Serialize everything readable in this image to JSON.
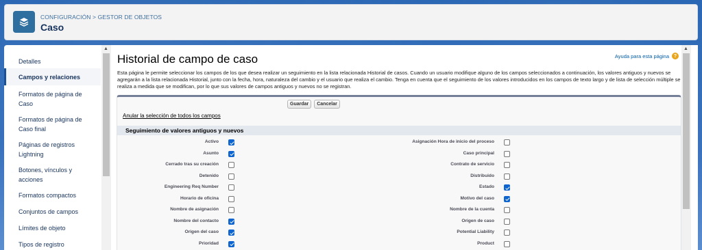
{
  "header": {
    "breadcrumb_1": "CONFIGURACIÓN",
    "breadcrumb_sep": ">",
    "breadcrumb_2": "GESTOR DE OBJETOS",
    "title": "Caso",
    "icon": "stack-layers-icon"
  },
  "sidebar": {
    "items": [
      {
        "label": "Detalles"
      },
      {
        "label": "Campos y relaciones",
        "active": true
      },
      {
        "label": "Formatos de página de Caso"
      },
      {
        "label": "Formatos de página de Caso final"
      },
      {
        "label": "Páginas de registros Lightning"
      },
      {
        "label": "Botones, vínculos y acciones"
      },
      {
        "label": "Formatos compactos"
      },
      {
        "label": "Conjuntos de campos"
      },
      {
        "label": "Límites de objeto"
      },
      {
        "label": "Tipos de registro"
      }
    ]
  },
  "main": {
    "title": "Historial de campo de caso",
    "help_label": "Ayuda para esta página",
    "description": "Esta página le permite seleccionar los campos de los que desea realizar un seguimiento en la lista relacionada Historial de casos. Cuando un usuario modifique alguno de los campos seleccionados a continuación, los valores antiguos y nuevos se agregarán a la lista relacionada Historial, junto con la fecha, hora, naturaleza del cambio y el usuario que realiza el cambio. Tenga en cuenta que el seguimiento de los valores introducidos en los campos de texto largo y de lista de selección múltiple se realiza a medida que se modifican, por lo que sus valores de campos antiguos y nuevos no se registran.",
    "save_label": "Guardar",
    "cancel_label": "Cancelar",
    "deselect_label": "Anular la selección de todos los campos",
    "section_title": "Seguimiento de valores antiguos y nuevos",
    "fields_left": [
      {
        "label": "Activo",
        "checked": true
      },
      {
        "label": "Asunto",
        "checked": true
      },
      {
        "label": "Cerrado tras su creación",
        "checked": false
      },
      {
        "label": "Detenido",
        "checked": false
      },
      {
        "label": "Engineering Req Number",
        "checked": false
      },
      {
        "label": "Horario de oficina",
        "checked": false
      },
      {
        "label": "Nombre de asignación",
        "checked": false
      },
      {
        "label": "Nombre del contacto",
        "checked": true
      },
      {
        "label": "Origen del caso",
        "checked": true
      },
      {
        "label": "Prioridad",
        "checked": true
      }
    ],
    "fields_right": [
      {
        "label": "Asignación Hora de inicio del proceso",
        "checked": false
      },
      {
        "label": "Caso principal",
        "checked": false
      },
      {
        "label": "Contrato de servicio",
        "checked": false
      },
      {
        "label": "Distribuido",
        "checked": false
      },
      {
        "label": "Estado",
        "checked": true
      },
      {
        "label": "Motivo del caso",
        "checked": true
      },
      {
        "label": "Nombre de la cuenta",
        "checked": false
      },
      {
        "label": "Origen de caso",
        "checked": false
      },
      {
        "label": "Potential Liability",
        "checked": false
      },
      {
        "label": "Product",
        "checked": false
      }
    ]
  }
}
